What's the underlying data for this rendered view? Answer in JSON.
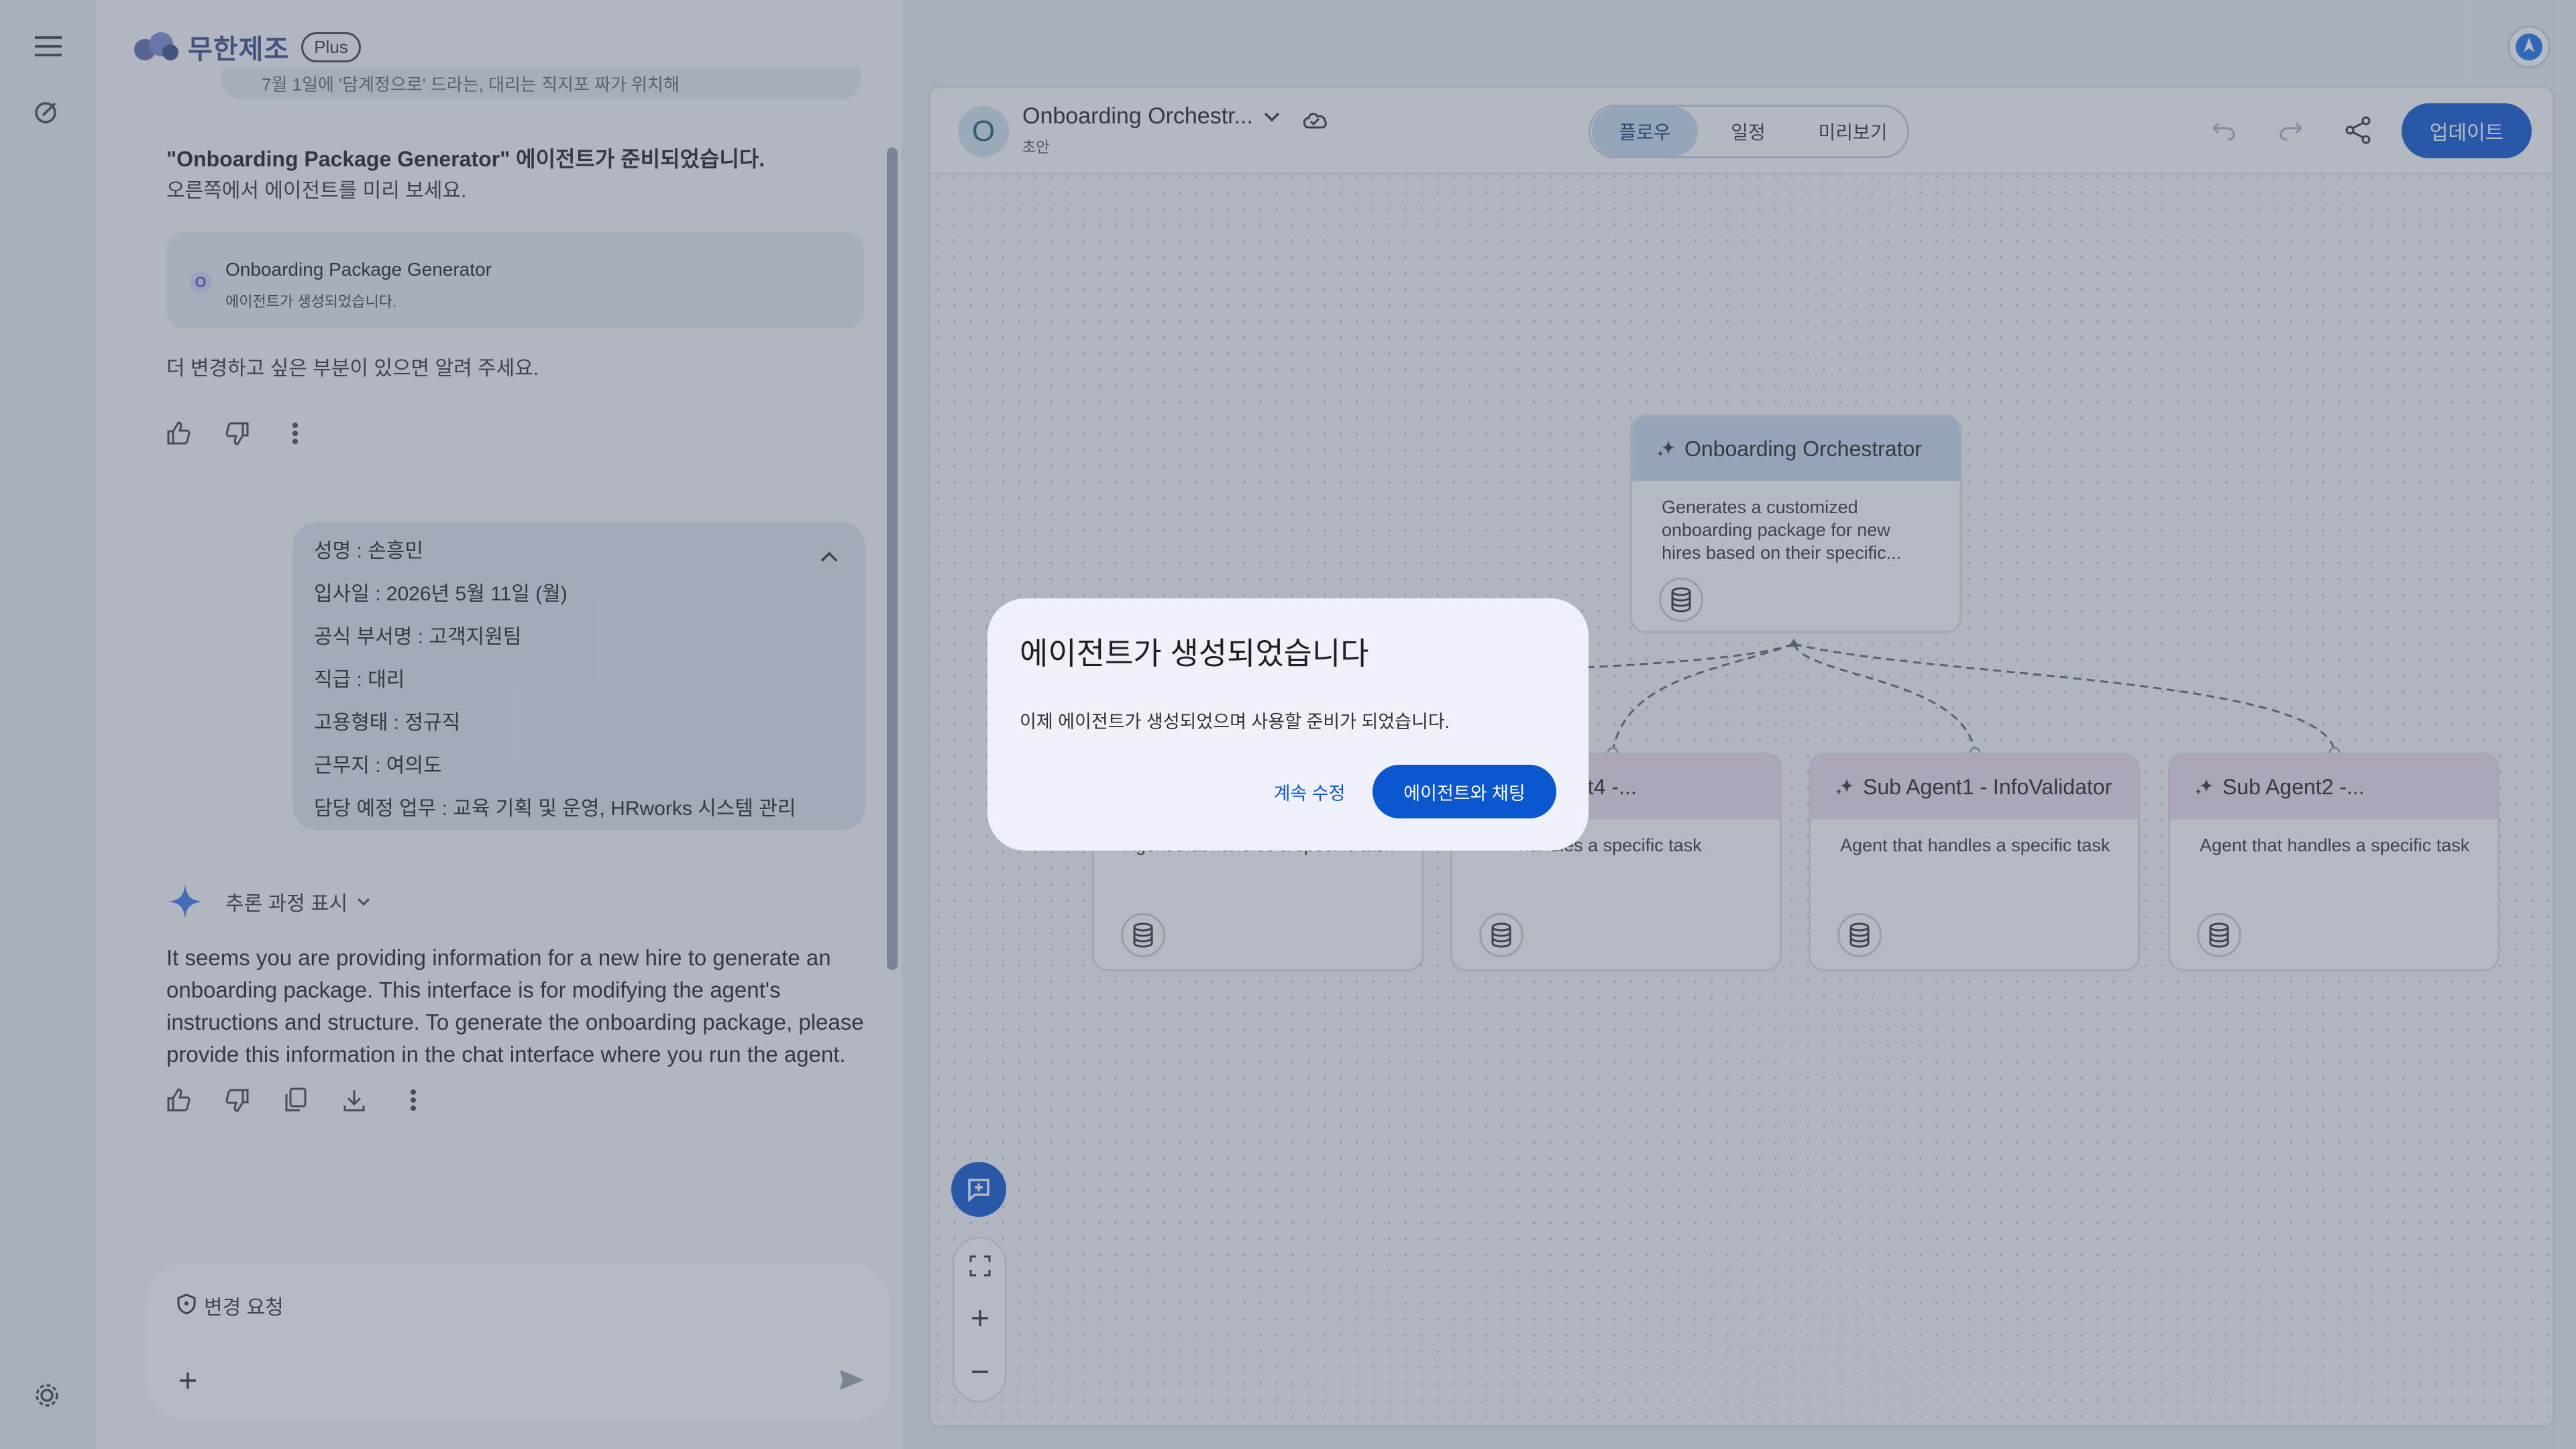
{
  "brand": {
    "name": "무한제조",
    "plan_badge": "Plus"
  },
  "chat": {
    "prev_cut_text": "7월 1일에 '담계정으로' 드라는, 대리는 직지포 짜가 위치해",
    "ready_title": "\"Onboarding Package Generator\" 에이전트가 준비되었습니다.",
    "ready_sub": "오른쪽에서 에이전트를 미리 보세요.",
    "agent_card": {
      "initial": "O",
      "name": "Onboarding Package Generator",
      "status": "에이전트가 생성되었습니다."
    },
    "tell_more": "더 변경하고 싶은 부분이 있으면 알려 주세요.",
    "user_message": [
      "성명 : 손흥민",
      "입사일 : 2026년 5월 11일 (월)",
      "공식 부서명 : 고객지원팀",
      "직급 : 대리",
      "고용형태 : 정규직",
      "근무지 : 여의도",
      "담당 예정 업무 : 교육 기획 및 운영, HRworks 시스템 관리"
    ],
    "show_reasoning": "추론 과정 표시",
    "answer": "It seems you are providing information for a new hire to generate an onboarding package. This interface is for modifying the agent's instructions and structure. To generate the onboarding package, please provide this information in the chat interface where you run the agent.",
    "input_label": "변경 요청"
  },
  "editor": {
    "agent_initial": "O",
    "agent_title": "Onboarding Orchestr...",
    "agent_status": "초안",
    "tabs": [
      "플로우",
      "일정",
      "미리보기"
    ],
    "active_tab": "플로우",
    "update_label": "업데이트"
  },
  "nodes": {
    "root": {
      "title": "Onboarding Orchestrator",
      "desc": [
        "Generates a customized",
        "onboarding package for new",
        "hires based on their specific..."
      ]
    },
    "sub_a": {
      "title": "",
      "desc": "...handles a specific task"
    },
    "sub_b": {
      "title": "...nt4 -...",
      "desc": "...handles a specific task"
    },
    "sub_c": {
      "title": "Sub Agent1 - InfoValidator",
      "desc": "Agent that handles a specific task"
    },
    "sub_d": {
      "title": "Sub Agent2 -...",
      "desc": "Agent that handles a specific task"
    },
    "sub_b_visible_title": "nt4 -...",
    "sub_ab_visible_desc": "handles a specific task"
  },
  "dialog": {
    "title": "에이전트가 생성되었습니다",
    "body": "이제 에이전트가 생성되었으며 사용할 준비가 되었습니다.",
    "continue_label": "계속 수정",
    "chat_label": "에이전트와 채팅"
  },
  "colors": {
    "accent": "#0b57d0",
    "root_head": "#c8daf0",
    "sub_head": "#ecdcef"
  }
}
